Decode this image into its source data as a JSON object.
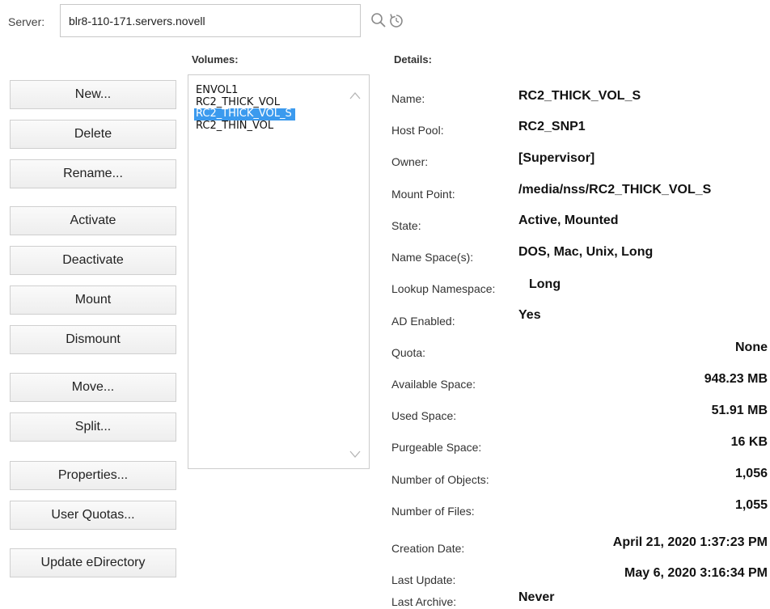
{
  "server": {
    "label": "Server:",
    "value": "blr8-110-171.servers.novell"
  },
  "icons": {
    "search": "search-icon",
    "refresh": "refresh-icon"
  },
  "headers": {
    "volumes": "Volumes:",
    "details": "Details:"
  },
  "buttons": {
    "new": "New...",
    "delete": "Delete",
    "rename": "Rename...",
    "activate": "Activate",
    "deactivate": "Deactivate",
    "mount": "Mount",
    "dismount": "Dismount",
    "move": "Move...",
    "split": "Split...",
    "properties": "Properties...",
    "user_quotas": "User Quotas...",
    "update_edirectory": "Update eDirectory"
  },
  "volumes": {
    "items": [
      "ENVOL1",
      "RC2_THICK_VOL",
      "RC2_THICK_VOL_S",
      "RC2_THIN_VOL"
    ],
    "selected": "RC2_THICK_VOL_S"
  },
  "details": {
    "name": {
      "label": "Name:",
      "value": "RC2_THICK_VOL_S"
    },
    "host_pool": {
      "label": "Host Pool:",
      "value": "RC2_SNP1"
    },
    "owner": {
      "label": "Owner:",
      "value": "[Supervisor]"
    },
    "mount_point": {
      "label": "Mount Point:",
      "value": "/media/nss/RC2_THICK_VOL_S"
    },
    "state": {
      "label": "State:",
      "value": "Active, Mounted"
    },
    "name_spaces": {
      "label": "Name Space(s):",
      "value": "DOS, Mac, Unix, Long"
    },
    "lookup_namespace": {
      "label": "Lookup Namespace:",
      "value": "Long"
    },
    "ad_enabled": {
      "label": "AD Enabled:",
      "value": "Yes"
    },
    "quota": {
      "label": "Quota:",
      "value": "None"
    },
    "available_space": {
      "label": "Available Space:",
      "value": "948.23 MB"
    },
    "used_space": {
      "label": "Used Space:",
      "value": "51.91 MB"
    },
    "purgeable_space": {
      "label": "Purgeable Space:",
      "value": "16 KB"
    },
    "number_of_objects": {
      "label": "Number of Objects:",
      "value": "1,056"
    },
    "number_of_files": {
      "label": "Number of Files:",
      "value": "1,055"
    },
    "creation_date": {
      "label": "Creation Date:",
      "value": "April 21, 2020 1:37:23 PM"
    },
    "last_update": {
      "label": "Last Update:",
      "value": "May 6, 2020 3:16:34 PM"
    },
    "last_archive": {
      "label": "Last Archive:",
      "value": "Never"
    }
  },
  "colors": {
    "selection": "#3b9aee",
    "border": "#cccccc",
    "button_bg": "#f2f2f2"
  }
}
